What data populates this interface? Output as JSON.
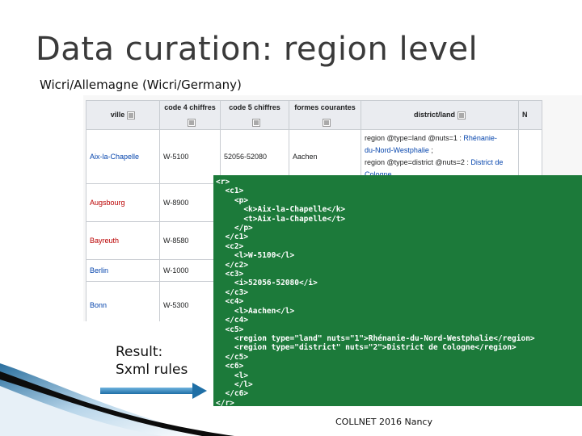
{
  "slide": {
    "title": "Data curation: region level",
    "subtitle": "Wicri/Allemagne (Wicri/Germany)",
    "result_line1": "Result:",
    "result_line2": "Sxml rules",
    "footer": "COLLNET 2016 Nancy",
    "colors": {
      "code_bg": "#1c7a3a",
      "link": "#0645ad",
      "redlink": "#ba0000",
      "arrow": "#2a86c0"
    }
  },
  "wiki_table": {
    "headers": [
      "ville",
      "code 4 chiffres",
      "code 5 chiffres",
      "formes courantes",
      "district/land",
      "N"
    ],
    "rows": [
      {
        "ville": "Aix-la-Chapelle",
        "code4": "W-5100",
        "code5": "52056-52080",
        "formes": "Aachen",
        "district_p1": "region @type=land @nuts=1 : ",
        "district_l1a": "Rhénanie-",
        "district_l1b": "du-Nord-Westphalie",
        "district_p2": " ;",
        "district_p3": "region @type=district @nuts=2 : ",
        "district_l2a": "District de",
        "district_l2b": "Cologne"
      },
      {
        "ville": "Augsbourg",
        "code4": "W-8900"
      },
      {
        "ville": "Bayreuth",
        "code4": "W-8580"
      },
      {
        "ville": "Berlin",
        "code4": "W-1000"
      },
      {
        "ville": "Bonn",
        "code4": "W-5300"
      }
    ]
  },
  "code_lines": [
    "<r>",
    "  <c1>",
    "    <p>",
    "      <k>Aix-la-Chapelle</k>",
    "      <t>Aix-la-Chapelle</t>",
    "    </p>",
    "  </c1>",
    "  <c2>",
    "    <l>W-5100</l>",
    "  </c2>",
    "  <c3>",
    "    <i>52056-52080</i>",
    "  </c3>",
    "  <c4>",
    "    <l>Aachen</l>",
    "  </c4>",
    "  <c5>",
    "    <region type=\"land\" nuts=\"1\">Rhénanie-du-Nord-Westphalie</region>",
    "    <region type=\"district\" nuts=\"2\">District de Cologne</region>",
    "  </c5>",
    "  <c6>",
    "    <l>",
    "    </l>",
    "  </c6>",
    "</r>"
  ]
}
